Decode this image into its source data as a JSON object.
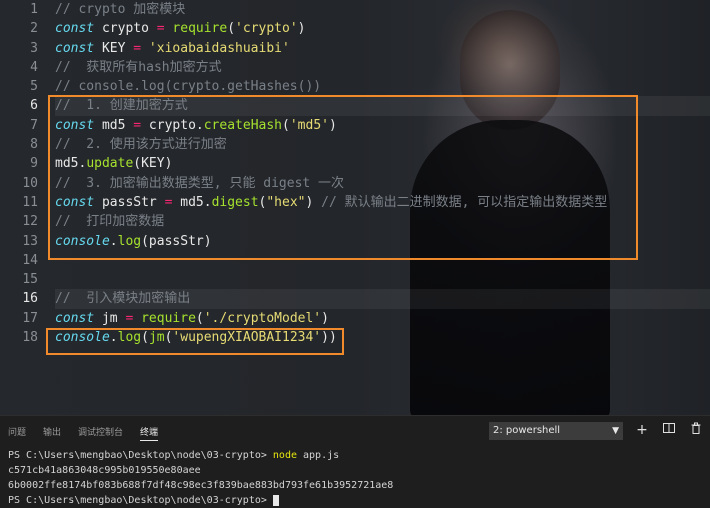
{
  "editor": {
    "line_numbers": [
      "1",
      "2",
      "3",
      "4",
      "5",
      "6",
      "7",
      "8",
      "9",
      "10",
      "11",
      "12",
      "13",
      "14",
      "15",
      "16",
      "17",
      "18"
    ],
    "lines": [
      {
        "t1": "// crypto 加密模块"
      },
      {
        "kw": "const",
        "id": " crypto",
        "op": " =",
        "fn": " require",
        "p1": "(",
        "str": "'crypto'",
        "p2": ")"
      },
      {
        "kw": "const",
        "id": " KEY",
        "op": " =",
        "str": " 'xioabaidashuaibi'"
      },
      {
        "t1": "//  获取所有hash加密方式"
      },
      {
        "t1": "// console.log(crypto.getHashes())"
      },
      {
        "t1": "//  1. 创建加密方式"
      },
      {
        "kw": "const",
        "id": " md5",
        "op": " =",
        "id2": " crypto.",
        "fn": "createHash",
        "p1": "(",
        "str": "'md5'",
        "p2": ")"
      },
      {
        "t1": "//  2. 使用该方式进行加密"
      },
      {
        "id": "md5.",
        "fn": "update",
        "p1": "(KEY)"
      },
      {
        "t1": "//  3. 加密输出数据类型, 只能 digest 一次"
      },
      {
        "kw": "const",
        "id": " passStr",
        "op": " =",
        "id2": " md5.",
        "fn": "digest",
        "p1": "(",
        "str": "\"hex\"",
        "p2": ")",
        "cm": " // 默认输出二进制数据, 可以指定输出数据类型"
      },
      {
        "t1": "//  打印加密数据"
      },
      {
        "con": "console",
        "id": ".",
        "fn": "log",
        "p1": "(passStr)"
      },
      {},
      {},
      {
        "t1": "//  引入模块加密输出"
      },
      {
        "kw": "const",
        "id": " jm",
        "op": " =",
        "fn": " require",
        "p1": "(",
        "str": "'./cryptoModel'",
        "p2": ")"
      },
      {
        "con": "console",
        "id": ".",
        "fn": "log",
        "p1": "(",
        "fn2": "jm",
        "p2": "(",
        "str": "'wupengXIAOBAI1234'",
        "p3": "))"
      }
    ]
  },
  "panel": {
    "tabs": [
      "问题",
      "输出",
      "调试控制台",
      "终端"
    ],
    "terminal_select": "2: powershell",
    "toolbar": {
      "add": "+",
      "split": "◫",
      "trash": "🗑"
    }
  },
  "terminal": {
    "lines": [
      {
        "prompt": "PS C:\\Users\\mengbao\\Desktop\\node\\03-crypto> ",
        "cmd": "node",
        "rest": " app.js"
      },
      {
        "text": "c571cb41a863048c995b019550e80aee"
      },
      {
        "text": "6b0002ffe8174bf083b688f7df48c98ec3f839bae883bd793fe61b3952721ae8"
      },
      {
        "prompt": "PS C:\\Users\\mengbao\\Desktop\\node\\03-crypto> ",
        "cursor": true
      }
    ]
  },
  "colors": {
    "highlight_box": "#f08a2a",
    "keyword": "#66d9ef",
    "string": "#e6db74",
    "function": "#a6e22e",
    "operator": "#f92672"
  }
}
